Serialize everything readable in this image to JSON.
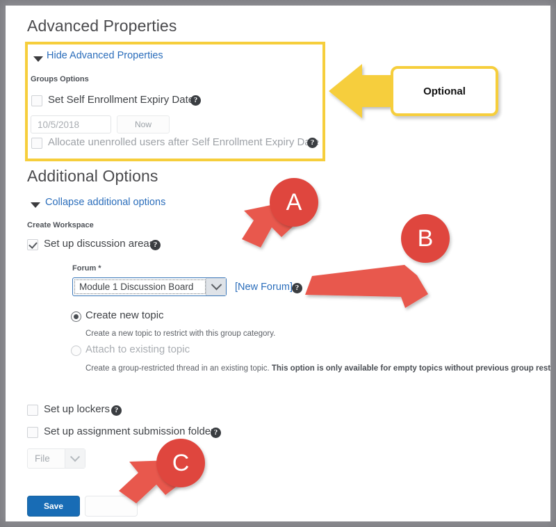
{
  "sections": {
    "advanced": {
      "heading": "Advanced Properties",
      "toggle_label": "Hide Advanced Properties",
      "group_label": "Groups Options",
      "expiry_checkbox_label": "Set Self Enrollment Expiry Date",
      "expiry_date_value": "10/5/2018",
      "now_button_label": "Now",
      "allocate_checkbox_label": "Allocate unenrolled users after Self Enrollment Expiry Date"
    },
    "additional": {
      "heading": "Additional Options",
      "toggle_label": "Collapse additional options",
      "create_workspace_label": "Create Workspace",
      "discussion_checkbox_label": "Set up discussion areas",
      "forum_field_label": "Forum *",
      "forum_selected": "Module 1 Discussion Board",
      "new_forum_link": "[New Forum]",
      "radio_new_topic_label": "Create new topic",
      "radio_new_topic_help": "Create a new topic to restrict with this group category.",
      "radio_existing_topic_label": "Attach to existing topic",
      "radio_existing_topic_help_normal": "Create a group-restricted thread in an existing topic. ",
      "radio_existing_topic_help_bold": "This option is only available for empty topics without previous group restrictions or posts.",
      "lockers_checkbox_label": "Set up lockers",
      "assignment_checkbox_label": "Set up assignment submission folders",
      "file_select_value": "File"
    }
  },
  "buttons": {
    "save_label": "Save",
    "cancel_label": ""
  },
  "annotations": {
    "callout_label": "Optional",
    "badge_a": "A",
    "badge_b": "B",
    "badge_c": "C"
  },
  "help_icon_glyph": "?",
  "colors": {
    "highlight_yellow": "#f6ce3c",
    "annotation_red": "#df463e",
    "arrow_red": "#e8594e",
    "link_blue": "#2a6dbb",
    "save_blue": "#186cb5"
  }
}
